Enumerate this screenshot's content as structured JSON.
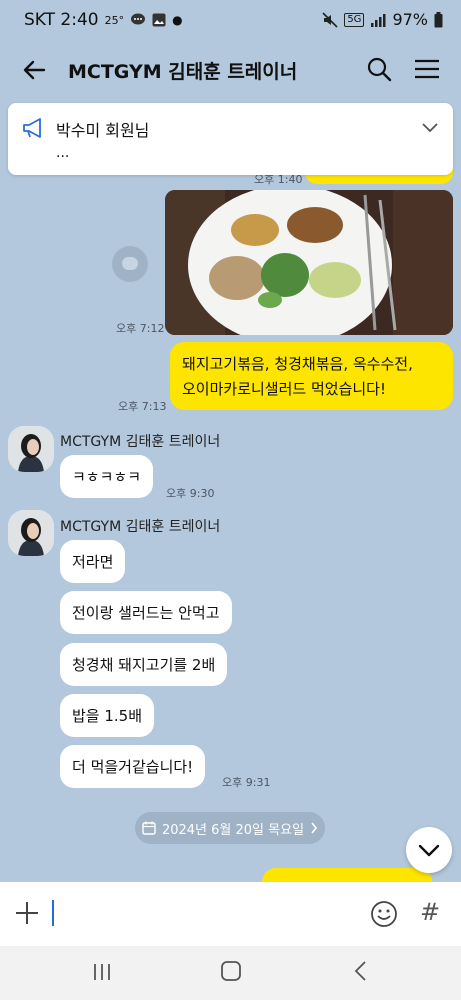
{
  "status_bar": {
    "carrier_time": "SKT 2:40",
    "temp": "25°",
    "network": "5G",
    "battery": "97%"
  },
  "header": {
    "title": "MCTGYM 김태훈 트레이너"
  },
  "notice": {
    "name": "박수미 회원님",
    "more": "..."
  },
  "partial_time": "오후 1:40",
  "messages": {
    "photo_time": "오후 7:12",
    "sent_text_line1": "돼지고기볶음, 청경채볶음, 옥수수전,",
    "sent_text_line2": "오이마카로니샐러드 먹었습니다!",
    "sent_time": "오후 7:13",
    "sender_name_1": "MCTGYM 김태훈 트레이너",
    "recv1_text": "ㅋㅎㅋㅎㅋ",
    "recv1_time": "오후 9:30",
    "sender_name_2": "MCTGYM 김태훈 트레이너",
    "recv2": [
      "저라면",
      "전이랑 샐러드는 안먹고",
      "청경채 돼지고기를 2배",
      "밥을 1.5배",
      "더 먹을거같습니다!"
    ],
    "recv2_time": "오후 9:31"
  },
  "date_chip": "2024년 6월 20일 목요일",
  "colors": {
    "bg": "#b3c8dd",
    "sent": "#fee500",
    "recv": "#ffffff"
  }
}
